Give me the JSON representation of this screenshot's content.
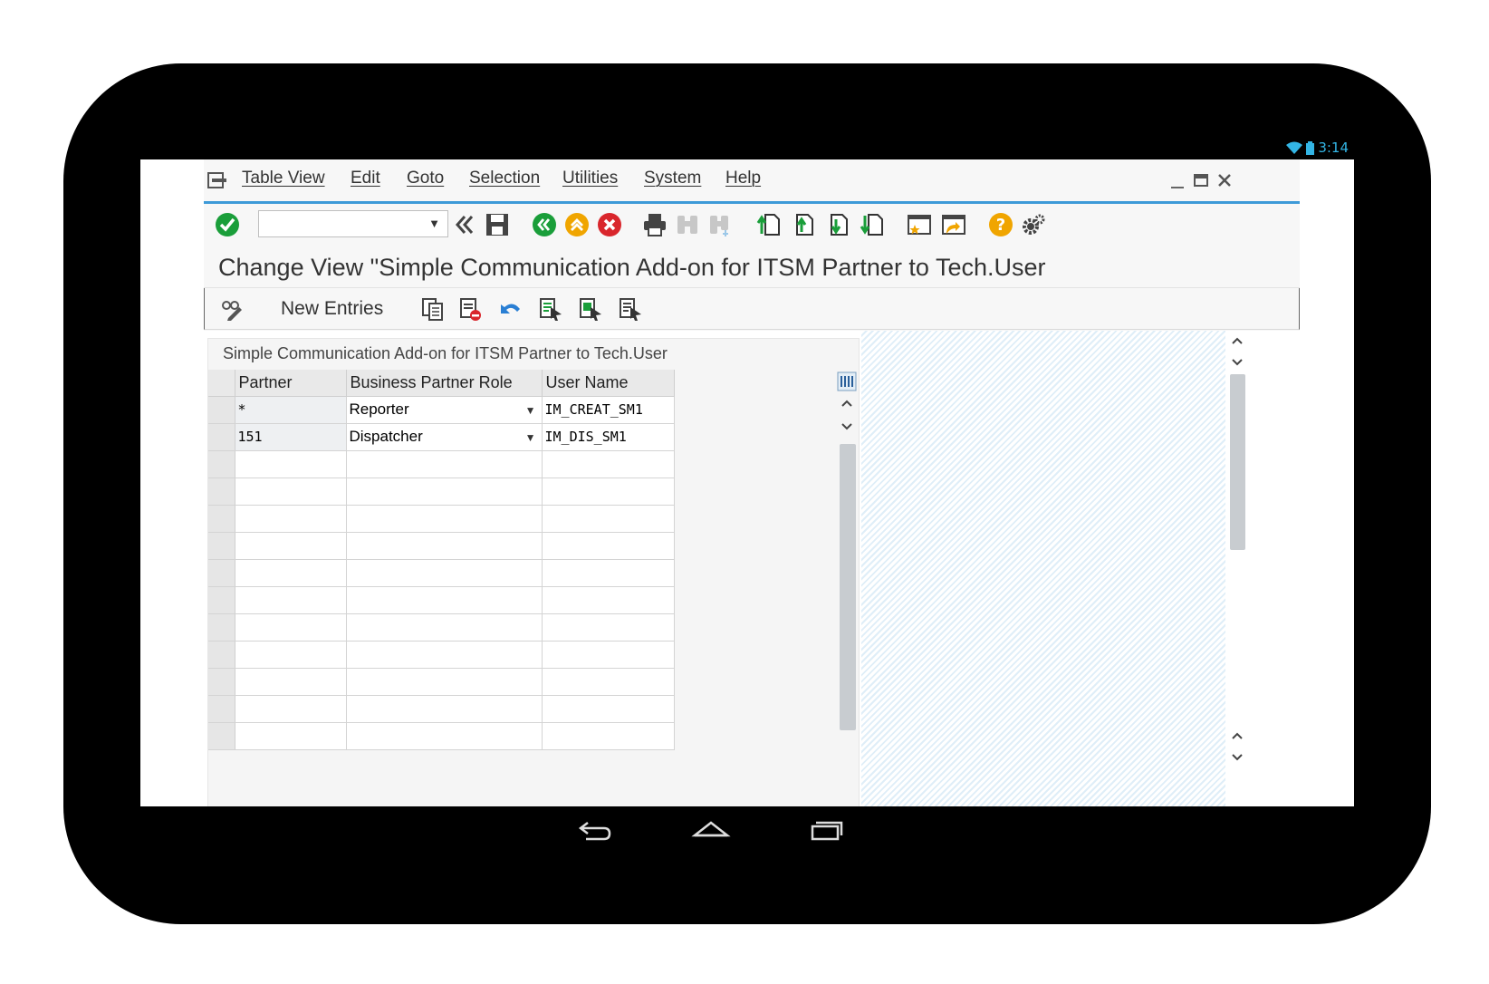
{
  "status": {
    "time": "3:14"
  },
  "menu": {
    "items": [
      "Table View",
      "Edit",
      "Goto",
      "Selection",
      "Utilities",
      "System",
      "Help"
    ]
  },
  "title": "Change View \"Simple Communication Add-on for ITSM Partner to Tech.User",
  "app_toolbar": {
    "new_entries": "New Entries"
  },
  "table": {
    "caption": "Simple Communication Add-on for ITSM Partner to Tech.User",
    "headers": [
      "Partner",
      "Business Partner Role",
      "User Name"
    ],
    "rows": [
      [
        "*",
        "Reporter",
        "IM_CREAT_SM1"
      ],
      [
        "151",
        "Dispatcher",
        "IM_DIS_SM1"
      ]
    ]
  },
  "colors": {
    "accent": "#3d9ad8",
    "ok_green": "#1a9e3a",
    "cancel_red": "#d9262c",
    "help_orange": "#f0a500"
  }
}
